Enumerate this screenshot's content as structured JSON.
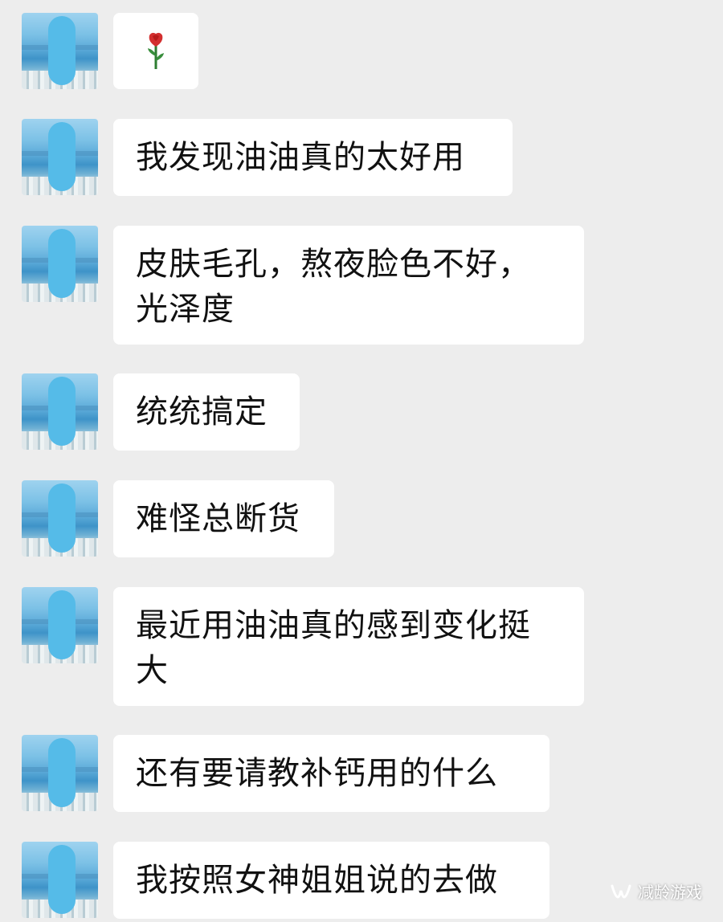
{
  "messages": [
    {
      "type": "emoji",
      "icon": "rose-icon"
    },
    {
      "type": "text",
      "text": "我发现油油真的太好用"
    },
    {
      "type": "text",
      "text": "皮肤毛孔，熬夜脸色不好，\n光泽度"
    },
    {
      "type": "text",
      "text": "统统搞定"
    },
    {
      "type": "text",
      "text": "难怪总断货"
    },
    {
      "type": "text",
      "text": "最近用油油真的感到变化挺\n大"
    },
    {
      "type": "text",
      "text": "还有要请教补钙用的什么"
    },
    {
      "type": "text",
      "text": "我按照女神姐姐说的去做"
    }
  ],
  "watermark": {
    "text": "减龄游戏",
    "icon": "wechat-channel-icon"
  },
  "colors": {
    "background": "#ededed",
    "bubble": "#ffffff",
    "text": "#111111"
  }
}
